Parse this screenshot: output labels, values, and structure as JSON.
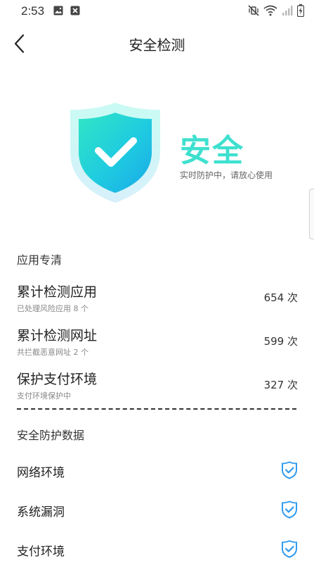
{
  "status_bar": {
    "time": "2:53",
    "left_icons": [
      "image-icon",
      "close-box-icon"
    ],
    "right_icons": [
      "mute-vibrate-icon",
      "wifi-icon",
      "signal-icon",
      "battery-charging-icon"
    ]
  },
  "header": {
    "title": "安全检测",
    "back_icon": "chevron-left-icon"
  },
  "hero": {
    "status": "安全",
    "subtitle": "实时防护中，请放心使用",
    "shield_icon": "shield-check-icon",
    "accent_color": "#3ee0cf"
  },
  "app_section": {
    "title": "应用专清",
    "items": [
      {
        "title": "累计检测应用",
        "subtitle": "已处理风险应用 8 个",
        "count": "654 次"
      },
      {
        "title": "累计检测网址",
        "subtitle": "共拦截恶意网址 2 个",
        "count": "599 次"
      },
      {
        "title": "保护支付环境",
        "subtitle": "支付环境保护中",
        "count": "327 次"
      }
    ]
  },
  "protection_section": {
    "title": "安全防护数据",
    "items": [
      {
        "label": "网络环境",
        "icon": "shield-check-icon"
      },
      {
        "label": "系统漏洞",
        "icon": "shield-check-icon"
      },
      {
        "label": "支付环境",
        "icon": "shield-check-icon"
      }
    ],
    "check_color": "#2f9bf0"
  }
}
